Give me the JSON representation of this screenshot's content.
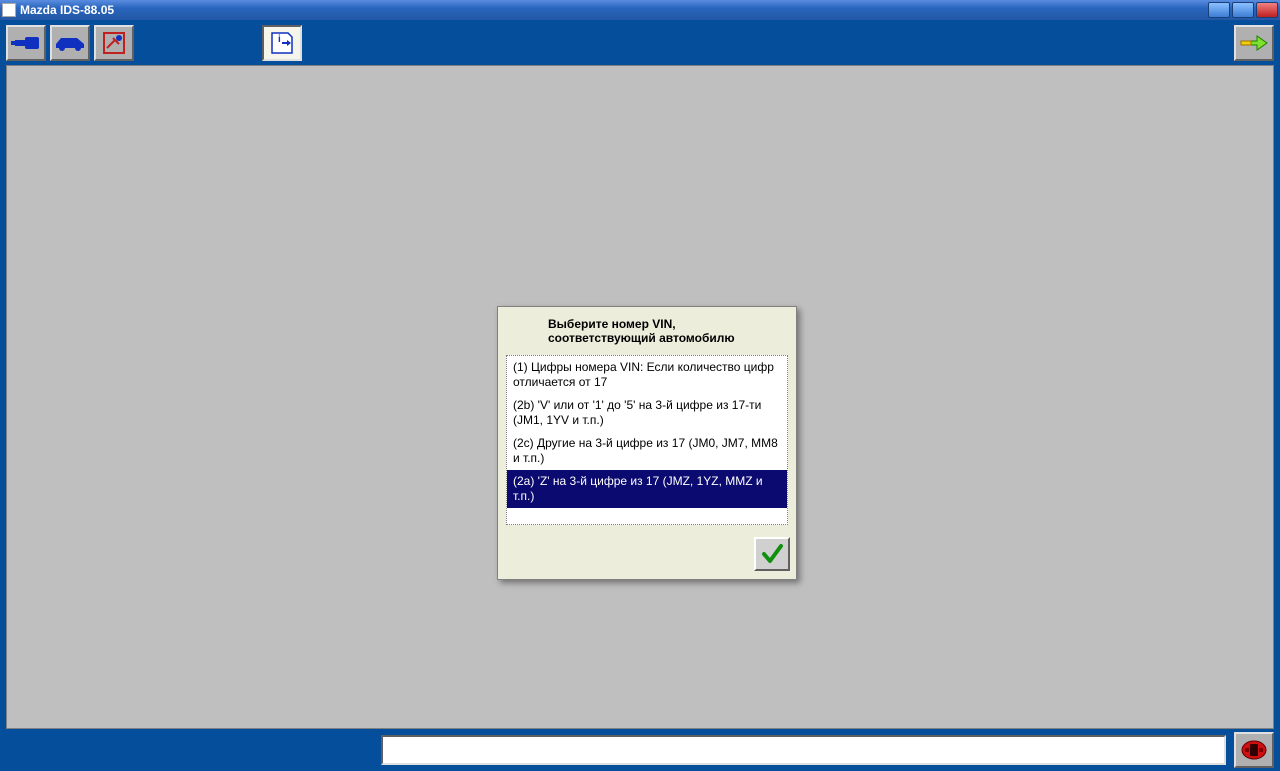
{
  "window": {
    "title": "Mazda IDS-88.05"
  },
  "toolbar": {
    "connect_icon": "connector-icon",
    "vehicle_icon": "car-icon",
    "tools_icon": "tools-icon",
    "info_icon": "info-icon",
    "next_icon": "arrow-right-icon",
    "emergency_icon": "emergency-icon"
  },
  "dialog": {
    "title": "Выберите номер VIN, соответствующий автомобилю",
    "items": [
      "(1) Цифры номера VIN: Если количество цифр отличается от 17",
      "(2b) 'V' или от '1' до '5' на 3-й цифре из 17-ти (JM1, 1YV и т.п.)",
      "(2c) Другие на 3-й цифре из 17 (JM0, JM7, MM8 и т.п.)",
      "(2a) 'Z' на 3-й цифре из 17 (JMZ, 1YZ, MMZ и т.п.)"
    ],
    "selected_index": 3,
    "ok_icon": "check-icon"
  },
  "statusbar": {
    "text": ""
  }
}
